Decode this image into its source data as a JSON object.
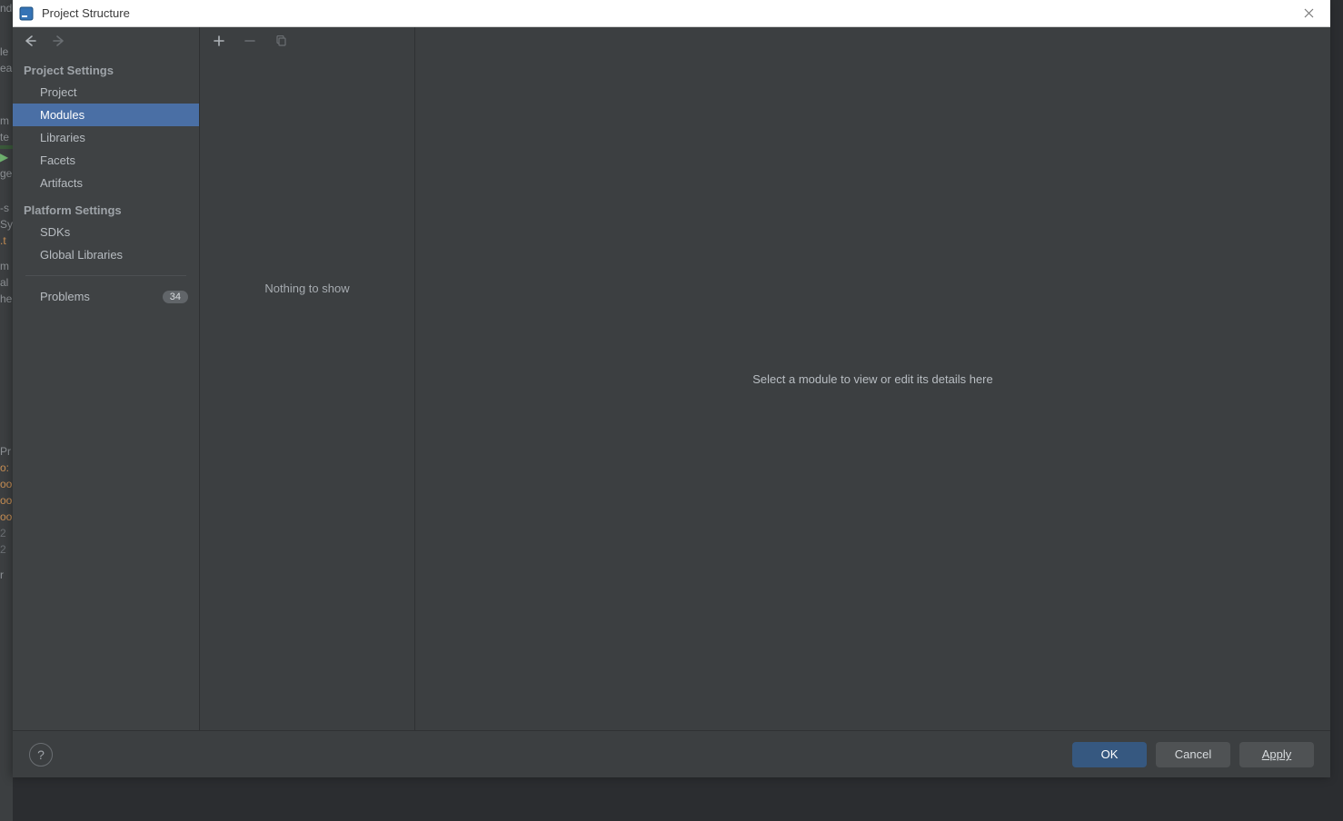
{
  "window": {
    "title": "Project Structure"
  },
  "sidebar": {
    "sections": [
      {
        "header": "Project Settings",
        "items": [
          "Project",
          "Modules",
          "Libraries",
          "Facets",
          "Artifacts"
        ]
      },
      {
        "header": "Platform Settings",
        "items": [
          "SDKs",
          "Global Libraries"
        ]
      }
    ],
    "selected": "Modules",
    "problems": {
      "label": "Problems",
      "count": "34"
    }
  },
  "middle": {
    "empty_text": "Nothing to show"
  },
  "detail": {
    "placeholder": "Select a module to view or edit its details here"
  },
  "footer": {
    "ok": "OK",
    "cancel": "Cancel",
    "apply": "Apply"
  },
  "bg_left_tokens": [
    "nd",
    "le",
    "ea",
    "m",
    "te",
    "",
    "",
    "ge",
    "-s",
    "Sy",
    ".t",
    "m",
    "al",
    "he"
  ],
  "bg_left_tokens2": [
    "Pr",
    "o:",
    "oo",
    "oo",
    "oo",
    "2",
    "2",
    "",
    "r"
  ]
}
